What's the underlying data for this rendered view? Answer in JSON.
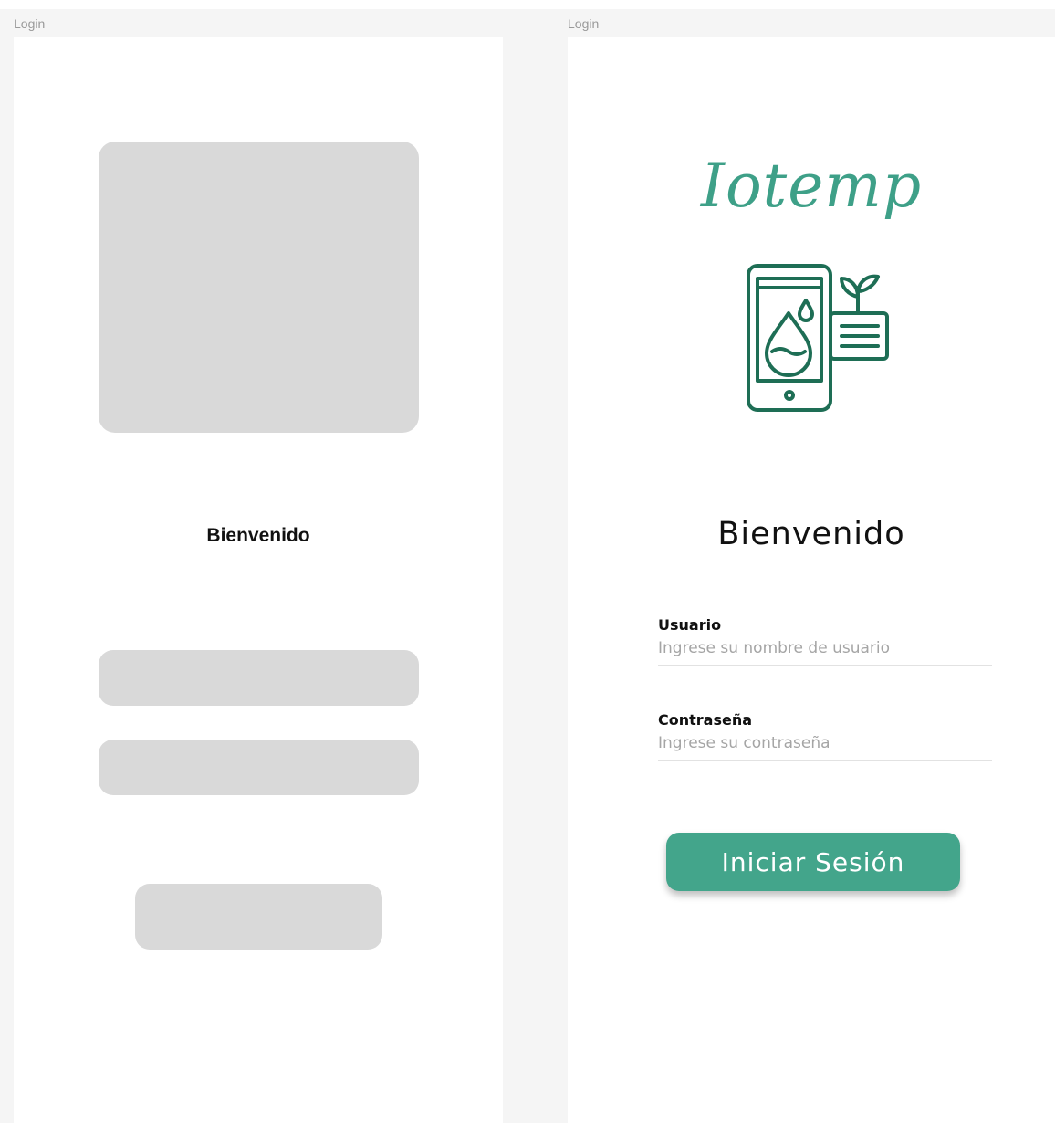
{
  "frames": [
    {
      "label": "Login",
      "type": "wireframe",
      "title": "Bienvenido"
    },
    {
      "label": "Login",
      "type": "design",
      "logo_text": "Iotemp",
      "title": "Bienvenido",
      "fields": [
        {
          "label": "Usuario",
          "placeholder": "Ingrese su nombre de usuario"
        },
        {
          "label": "Contraseña",
          "placeholder": "Ingrese su contraseña"
        }
      ],
      "button_label": "Iniciar Sesión"
    }
  ],
  "colors": {
    "accent": "#43a58b",
    "logo": "#3ea088",
    "icon": "#1e6e55",
    "placeholder_gray": "#d9d9d9",
    "canvas": "#f5f5f5"
  },
  "icons": {
    "logo_icon": "phone-water-drop-plant-icon"
  }
}
